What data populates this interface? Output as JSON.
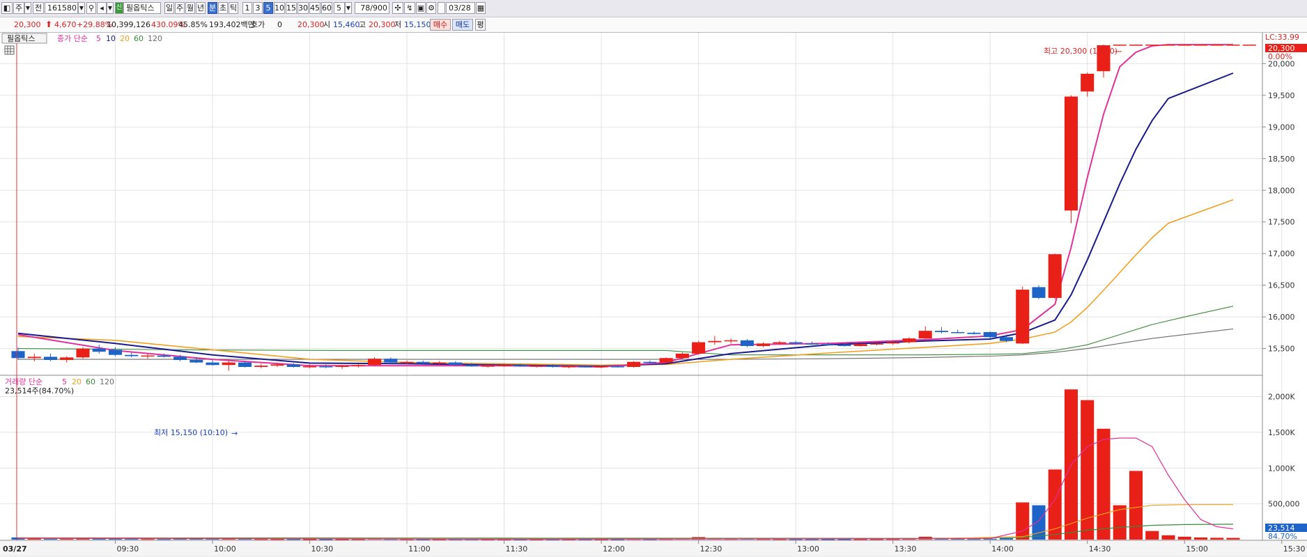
{
  "toolbar": {
    "mode_label": "주",
    "jeon_label": "전",
    "code": "161580",
    "badge": "신",
    "stock_name": "필옵틱스",
    "periods": [
      "일",
      "주",
      "월",
      "년",
      "분",
      "초",
      "틱"
    ],
    "intervals": [
      "1",
      "3",
      "5",
      "10",
      "15",
      "30",
      "45",
      "60"
    ],
    "selected_period": "분",
    "selected_interval": "5",
    "interval_value": "5",
    "count_value": "78",
    "count_max": "/900",
    "date_value": "03/28"
  },
  "quote": {
    "price": "20,300",
    "change": "4,670",
    "change_pct": "+29.88%",
    "volume": "10,399,126",
    "vol_ratio": "430.09%",
    "turnover": "45.85%",
    "amount": "193,402백만",
    "hoga_label": "호가",
    "hoga_value": "0",
    "hoga_price": "20,300",
    "open_label": "시",
    "open": "15,460",
    "high_label": "고",
    "high": "20,300",
    "low_label": "저",
    "low": "15,150",
    "buy_label": "매수",
    "sell_label": "매도",
    "pyeong_label": "평"
  },
  "price_panel": {
    "stock_tag": "필옵틱스",
    "legend_title": "종가 단순",
    "ma_periods": [
      "5",
      "10",
      "20",
      "60",
      "120"
    ],
    "lc_label": "LC:33.99",
    "last_price_badge": "20,300",
    "pct_label": "0.00%",
    "high_note": "최고 20,300 (14:50)",
    "low_note": "최저 15,150 (10:10)"
  },
  "volume_panel": {
    "legend_title": "거래량 단순",
    "ma_periods": [
      "5",
      "20",
      "60",
      "120"
    ],
    "info": "23,514주(84.70%)",
    "last_badge": "23,514",
    "pct_badge": "84.70%"
  },
  "colors": {
    "up": "#e82018",
    "down": "#1e64c8",
    "ma5": "#e0309a",
    "ma10": "#1a1a8c",
    "ma20": "#f0a020",
    "ma60": "#3a8a3a",
    "ma120": "#6a6a6a"
  },
  "chart_data": {
    "type": "candlestick",
    "price_axis": {
      "ticks": [
        15500,
        16000,
        16500,
        17000,
        17500,
        18000,
        18500,
        19000,
        19500,
        20000
      ],
      "ylim": [
        15100,
        20400
      ]
    },
    "volume_axis": {
      "ticks": [
        500000,
        1000000,
        1500000,
        2000000
      ],
      "tick_labels": [
        "500,000",
        "1,000K",
        "1,500K",
        "2,000K"
      ],
      "ylim": [
        0,
        2200000
      ]
    },
    "x_axis": {
      "date_label": "03/27",
      "time_labels": [
        "09:30",
        "10:00",
        "10:30",
        "11:00",
        "11:30",
        "12:00",
        "12:30",
        "13:00",
        "13:30",
        "14:00",
        "14:30",
        "15:00",
        "15:30"
      ]
    },
    "candles": [
      {
        "o": 15460,
        "h": 15520,
        "l": 15320,
        "c": 15350
      },
      {
        "o": 15350,
        "h": 15420,
        "l": 15300,
        "c": 15370
      },
      {
        "o": 15370,
        "h": 15420,
        "l": 15300,
        "c": 15320
      },
      {
        "o": 15320,
        "h": 15380,
        "l": 15280,
        "c": 15360
      },
      {
        "o": 15360,
        "h": 15520,
        "l": 15340,
        "c": 15500
      },
      {
        "o": 15500,
        "h": 15560,
        "l": 15420,
        "c": 15450
      },
      {
        "o": 15480,
        "h": 15520,
        "l": 15380,
        "c": 15400
      },
      {
        "o": 15400,
        "h": 15440,
        "l": 15360,
        "c": 15380
      },
      {
        "o": 15380,
        "h": 15420,
        "l": 15340,
        "c": 15390
      },
      {
        "o": 15390,
        "h": 15420,
        "l": 15360,
        "c": 15370
      },
      {
        "o": 15370,
        "h": 15400,
        "l": 15300,
        "c": 15320
      },
      {
        "o": 15320,
        "h": 15360,
        "l": 15270,
        "c": 15280
      },
      {
        "o": 15280,
        "h": 15320,
        "l": 15230,
        "c": 15240
      },
      {
        "o": 15240,
        "h": 15300,
        "l": 15150,
        "c": 15280
      },
      {
        "o": 15280,
        "h": 15300,
        "l": 15200,
        "c": 15210
      },
      {
        "o": 15210,
        "h": 15260,
        "l": 15190,
        "c": 15230
      },
      {
        "o": 15230,
        "h": 15270,
        "l": 15210,
        "c": 15250
      },
      {
        "o": 15250,
        "h": 15270,
        "l": 15200,
        "c": 15210
      },
      {
        "o": 15210,
        "h": 15250,
        "l": 15190,
        "c": 15220
      },
      {
        "o": 15220,
        "h": 15250,
        "l": 15190,
        "c": 15210
      },
      {
        "o": 15210,
        "h": 15240,
        "l": 15180,
        "c": 15230
      },
      {
        "o": 15230,
        "h": 15260,
        "l": 15200,
        "c": 15240
      },
      {
        "o": 15240,
        "h": 15360,
        "l": 15220,
        "c": 15340
      },
      {
        "o": 15340,
        "h": 15360,
        "l": 15260,
        "c": 15280
      },
      {
        "o": 15280,
        "h": 15310,
        "l": 15250,
        "c": 15290
      },
      {
        "o": 15290,
        "h": 15310,
        "l": 15260,
        "c": 15270
      },
      {
        "o": 15270,
        "h": 15300,
        "l": 15240,
        "c": 15280
      },
      {
        "o": 15280,
        "h": 15300,
        "l": 15230,
        "c": 15240
      },
      {
        "o": 15240,
        "h": 15270,
        "l": 15210,
        "c": 15220
      },
      {
        "o": 15220,
        "h": 15250,
        "l": 15200,
        "c": 15230
      },
      {
        "o": 15230,
        "h": 15260,
        "l": 15210,
        "c": 15240
      },
      {
        "o": 15240,
        "h": 15260,
        "l": 15210,
        "c": 15220
      },
      {
        "o": 15220,
        "h": 15250,
        "l": 15200,
        "c": 15230
      },
      {
        "o": 15230,
        "h": 15250,
        "l": 15200,
        "c": 15210
      },
      {
        "o": 15210,
        "h": 15240,
        "l": 15190,
        "c": 15220
      },
      {
        "o": 15220,
        "h": 15240,
        "l": 15200,
        "c": 15210
      },
      {
        "o": 15210,
        "h": 15230,
        "l": 15190,
        "c": 15220
      },
      {
        "o": 15220,
        "h": 15240,
        "l": 15200,
        "c": 15210
      },
      {
        "o": 15210,
        "h": 15300,
        "l": 15200,
        "c": 15290
      },
      {
        "o": 15290,
        "h": 15310,
        "l": 15260,
        "c": 15280
      },
      {
        "o": 15280,
        "h": 15360,
        "l": 15270,
        "c": 15350
      },
      {
        "o": 15350,
        "h": 15440,
        "l": 15340,
        "c": 15420
      },
      {
        "o": 15420,
        "h": 15620,
        "l": 15410,
        "c": 15600
      },
      {
        "o": 15600,
        "h": 15700,
        "l": 15560,
        "c": 15620
      },
      {
        "o": 15620,
        "h": 15660,
        "l": 15580,
        "c": 15630
      },
      {
        "o": 15630,
        "h": 15650,
        "l": 15520,
        "c": 15540
      },
      {
        "o": 15540,
        "h": 15600,
        "l": 15520,
        "c": 15580
      },
      {
        "o": 15580,
        "h": 15620,
        "l": 15560,
        "c": 15600
      },
      {
        "o": 15600,
        "h": 15620,
        "l": 15560,
        "c": 15580
      },
      {
        "o": 15580,
        "h": 15610,
        "l": 15560,
        "c": 15570
      },
      {
        "o": 15570,
        "h": 15600,
        "l": 15550,
        "c": 15560
      },
      {
        "o": 15560,
        "h": 15580,
        "l": 15530,
        "c": 15540
      },
      {
        "o": 15540,
        "h": 15580,
        "l": 15530,
        "c": 15570
      },
      {
        "o": 15570,
        "h": 15600,
        "l": 15550,
        "c": 15580
      },
      {
        "o": 15580,
        "h": 15620,
        "l": 15560,
        "c": 15600
      },
      {
        "o": 15600,
        "h": 15680,
        "l": 15580,
        "c": 15660
      },
      {
        "o": 15660,
        "h": 15850,
        "l": 15640,
        "c": 15780
      },
      {
        "o": 15780,
        "h": 15840,
        "l": 15740,
        "c": 15760
      },
      {
        "o": 15760,
        "h": 15800,
        "l": 15740,
        "c": 15750
      },
      {
        "o": 15750,
        "h": 15770,
        "l": 15720,
        "c": 15730
      },
      {
        "o": 15760,
        "h": 15770,
        "l": 15660,
        "c": 15680
      },
      {
        "o": 15680,
        "h": 15720,
        "l": 15600,
        "c": 15620
      },
      {
        "o": 15580,
        "h": 16480,
        "l": 15570,
        "c": 16430
      },
      {
        "o": 16470,
        "h": 16500,
        "l": 16280,
        "c": 16300
      },
      {
        "o": 16300,
        "h": 17000,
        "l": 16280,
        "c": 16990
      },
      {
        "o": 17680,
        "h": 19500,
        "l": 17480,
        "c": 19480
      },
      {
        "o": 19560,
        "h": 19860,
        "l": 19480,
        "c": 19840
      },
      {
        "o": 19880,
        "h": 20300,
        "l": 19780,
        "c": 20290
      },
      {
        "o": 20300,
        "h": 20300,
        "l": 20280,
        "c": 20300
      },
      {
        "o": 20300,
        "h": 20300,
        "l": 20290,
        "c": 20300
      },
      {
        "o": 20300,
        "h": 20300,
        "l": 20300,
        "c": 20300
      },
      {
        "o": 20300,
        "h": 20300,
        "l": 20300,
        "c": 20300
      },
      {
        "o": 20300,
        "h": 20300,
        "l": 20300,
        "c": 20300
      },
      {
        "o": 20300,
        "h": 20300,
        "l": 20300,
        "c": 20300
      },
      {
        "o": 20300,
        "h": 20300,
        "l": 20300,
        "c": 20300
      },
      {
        "o": 20300,
        "h": 20300,
        "l": 20300,
        "c": 20300
      },
      {
        "o": 20300,
        "h": 20300,
        "l": 20300,
        "c": 20300
      }
    ],
    "volume": [
      30000,
      15000,
      12000,
      10000,
      25000,
      20000,
      12000,
      9000,
      8000,
      7000,
      10000,
      12000,
      10000,
      15000,
      9000,
      7000,
      6000,
      6000,
      5000,
      5000,
      5000,
      6000,
      12000,
      8000,
      6000,
      5000,
      5000,
      6000,
      6000,
      5000,
      5000,
      5000,
      5000,
      5000,
      5000,
      5000,
      5000,
      5000,
      8000,
      6000,
      8000,
      10000,
      35000,
      15000,
      9000,
      10000,
      8000,
      7000,
      6000,
      6000,
      5000,
      5000,
      6000,
      6000,
      7000,
      9000,
      40000,
      15000,
      10000,
      8000,
      12000,
      20000,
      520000,
      480000,
      980000,
      2100000,
      1950000,
      1550000,
      480000,
      960000,
      120000,
      60000,
      40000,
      30000,
      25000,
      23514
    ],
    "ma": {
      "5": [
        [
          0,
          15720
        ],
        [
          6,
          15470
        ],
        [
          12,
          15330
        ],
        [
          18,
          15230
        ],
        [
          24,
          15230
        ],
        [
          30,
          15230
        ],
        [
          36,
          15210
        ],
        [
          40,
          15280
        ],
        [
          44,
          15560
        ],
        [
          50,
          15580
        ],
        [
          56,
          15640
        ],
        [
          60,
          15700
        ],
        [
          62,
          15800
        ],
        [
          64,
          16200
        ],
        [
          65,
          17100
        ],
        [
          66,
          18200
        ],
        [
          67,
          19200
        ],
        [
          68,
          19950
        ],
        [
          69,
          20180
        ],
        [
          70,
          20280
        ],
        [
          71,
          20300
        ],
        [
          75,
          20300
        ]
      ],
      "10": [
        [
          0,
          15740
        ],
        [
          6,
          15580
        ],
        [
          12,
          15400
        ],
        [
          18,
          15270
        ],
        [
          24,
          15260
        ],
        [
          30,
          15240
        ],
        [
          36,
          15220
        ],
        [
          40,
          15260
        ],
        [
          44,
          15420
        ],
        [
          50,
          15560
        ],
        [
          56,
          15620
        ],
        [
          60,
          15650
        ],
        [
          62,
          15750
        ],
        [
          64,
          15950
        ],
        [
          65,
          16350
        ],
        [
          66,
          16900
        ],
        [
          67,
          17500
        ],
        [
          68,
          18100
        ],
        [
          69,
          18650
        ],
        [
          70,
          19100
        ],
        [
          71,
          19450
        ],
        [
          75,
          19850
        ]
      ],
      "20": [
        [
          0,
          15690
        ],
        [
          6,
          15630
        ],
        [
          12,
          15480
        ],
        [
          18,
          15330
        ],
        [
          24,
          15280
        ],
        [
          30,
          15260
        ],
        [
          36,
          15240
        ],
        [
          40,
          15250
        ],
        [
          44,
          15330
        ],
        [
          50,
          15430
        ],
        [
          56,
          15520
        ],
        [
          60,
          15580
        ],
        [
          62,
          15650
        ],
        [
          64,
          15760
        ],
        [
          65,
          15920
        ],
        [
          66,
          16150
        ],
        [
          67,
          16420
        ],
        [
          68,
          16700
        ],
        [
          69,
          16980
        ],
        [
          70,
          17250
        ],
        [
          71,
          17480
        ],
        [
          75,
          17850
        ]
      ],
      "60": [
        [
          0,
          15500
        ],
        [
          10,
          15480
        ],
        [
          20,
          15470
        ],
        [
          30,
          15470
        ],
        [
          40,
          15470
        ],
        [
          44,
          15400
        ],
        [
          50,
          15400
        ],
        [
          56,
          15400
        ],
        [
          60,
          15410
        ],
        [
          62,
          15420
        ],
        [
          64,
          15470
        ],
        [
          66,
          15560
        ],
        [
          68,
          15720
        ],
        [
          70,
          15880
        ],
        [
          72,
          16000
        ],
        [
          75,
          16170
        ]
      ],
      "120": [
        [
          0,
          15330
        ],
        [
          20,
          15330
        ],
        [
          40,
          15330
        ],
        [
          44,
          15330
        ],
        [
          50,
          15340
        ],
        [
          56,
          15360
        ],
        [
          60,
          15380
        ],
        [
          62,
          15400
        ],
        [
          64,
          15440
        ],
        [
          66,
          15500
        ],
        [
          68,
          15580
        ],
        [
          70,
          15660
        ],
        [
          72,
          15720
        ],
        [
          75,
          15810
        ]
      ]
    },
    "vol_ma": {
      "5": [
        [
          0,
          18000
        ],
        [
          30,
          6000
        ],
        [
          56,
          12000
        ],
        [
          60,
          15000
        ],
        [
          62,
          120000
        ],
        [
          63,
          260000
        ],
        [
          64,
          560000
        ],
        [
          65,
          1050000
        ],
        [
          66,
          1300000
        ],
        [
          67,
          1400000
        ],
        [
          68,
          1420000
        ],
        [
          69,
          1420000
        ],
        [
          70,
          1300000
        ],
        [
          71,
          900000
        ],
        [
          72,
          560000
        ],
        [
          73,
          280000
        ],
        [
          74,
          180000
        ],
        [
          75,
          150000
        ]
      ],
      "20": [
        [
          0,
          20000
        ],
        [
          30,
          10000
        ],
        [
          56,
          12000
        ],
        [
          62,
          40000
        ],
        [
          64,
          150000
        ],
        [
          66,
          300000
        ],
        [
          68,
          420000
        ],
        [
          70,
          480000
        ],
        [
          72,
          490000
        ],
        [
          75,
          490000
        ]
      ],
      "60": [
        [
          0,
          25000
        ],
        [
          30,
          20000
        ],
        [
          56,
          18000
        ],
        [
          62,
          30000
        ],
        [
          64,
          70000
        ],
        [
          66,
          130000
        ],
        [
          68,
          170000
        ],
        [
          70,
          200000
        ],
        [
          72,
          210000
        ],
        [
          75,
          215000
        ]
      ]
    }
  }
}
